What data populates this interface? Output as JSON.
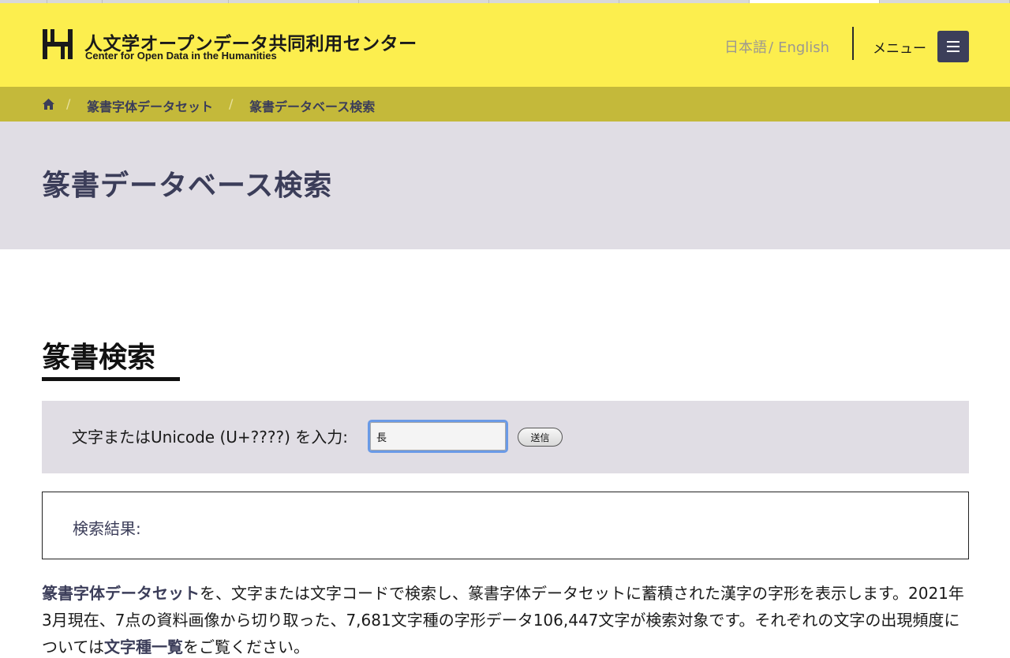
{
  "header": {
    "title_ja": "人文学オープンデータ共同利用センター",
    "title_en": "Center for Open Data in the Humanities",
    "lang_ja": "日本語",
    "lang_sep": "/",
    "lang_en": "English",
    "menu_label": "メニュー"
  },
  "breadcrumb": {
    "items": [
      "篆書字体データセット",
      "篆書データベース検索"
    ],
    "separator": "/"
  },
  "page": {
    "title": "篆書データベース検索"
  },
  "search": {
    "heading": "篆書検索",
    "label": "文字またはUnicode (U+????) を入力:",
    "input_value": "長",
    "submit_label": "送信"
  },
  "results": {
    "label": "検索結果:"
  },
  "description": {
    "link1": "篆書字体データセット",
    "text1": "を、文字または文字コードで検索し、篆書字体データセットに蓄積された漢字の字形を表示します。2021年3月現在、7点の資料画像から切り取った、7,681文字種の字形データ106,447文字が検索対象です。それぞれの文字の出現頻度については",
    "link2": "文字種一覧",
    "text2": "をご覧ください。"
  },
  "colors": {
    "header_bg": "#fcee4e",
    "breadcrumb_bg": "#c4b93a",
    "banner_bg": "#e0dde4",
    "accent_navy": "#3b3d59",
    "menu_button": "#3c3f5a",
    "input_focus": "#6a9ae6"
  },
  "icons": {
    "logo": "codh-logo-icon",
    "home": "home-icon",
    "menu": "hamburger-icon"
  }
}
